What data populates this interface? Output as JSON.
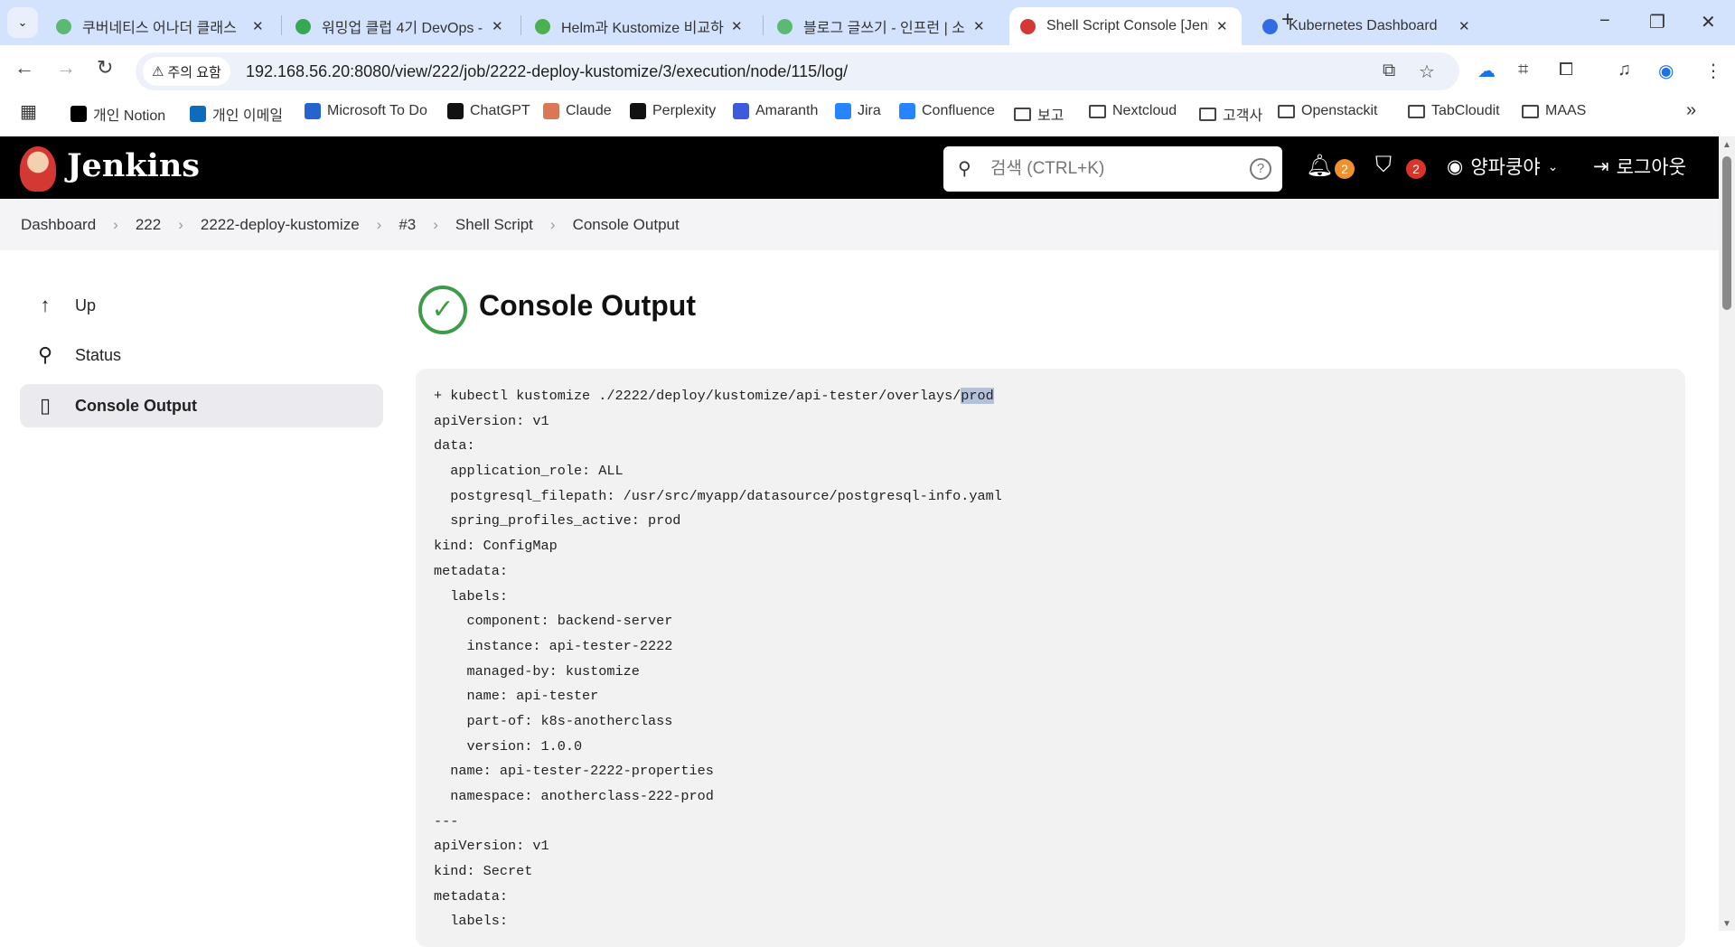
{
  "browser": {
    "tabs": [
      {
        "label": "쿠버네티스 어나더 클래스",
        "color": "#5bb974"
      },
      {
        "label": "워밍업 클럽 4기 DevOps -",
        "color": "#34a853"
      },
      {
        "label": "Helm과 Kustomize 비교하",
        "color": "#4caf50"
      },
      {
        "label": "블로그 글쓰기 - 인프런 | 소",
        "color": "#5bb974"
      },
      {
        "label": "Shell Script Console [Jenki",
        "color": "#d33833",
        "active": true
      },
      {
        "label": "Kubernetes Dashboard",
        "color": "#326ce5"
      }
    ],
    "security_label": "주의 요함",
    "url": "192.168.56.20:8080/view/222/job/2222-deploy-kustomize/3/execution/node/115/log/",
    "bookmarks": [
      {
        "label": "개인 Notion",
        "color": "#000000"
      },
      {
        "label": "개인 이메일",
        "color": "#0f6cbd"
      },
      {
        "label": "Microsoft To Do",
        "color": "#2564cf"
      },
      {
        "label": "ChatGPT",
        "color": "#111111"
      },
      {
        "label": "Claude",
        "color": "#d97757"
      },
      {
        "label": "Perplexity",
        "color": "#111111"
      },
      {
        "label": "Amaranth",
        "color": "#3b5bdb"
      },
      {
        "label": "Jira",
        "color": "#2684ff"
      },
      {
        "label": "Confluence",
        "color": "#2684ff"
      },
      {
        "label": "보고",
        "folder": true
      },
      {
        "label": "Nextcloud",
        "folder": true
      },
      {
        "label": "고객사",
        "folder": true
      },
      {
        "label": "Openstackit",
        "folder": true
      },
      {
        "label": "TabCloudit",
        "folder": true
      },
      {
        "label": "MAAS",
        "folder": true
      }
    ]
  },
  "jenkins": {
    "title": "Jenkins",
    "search_placeholder": "검색 (CTRL+K)",
    "notifications_count": "2",
    "security_count": "2",
    "user": "양파쿵야",
    "logout": "로그아웃",
    "colors": {
      "notif": "#f0912f",
      "security": "#d9342b",
      "success": "#3d9b4a"
    }
  },
  "breadcrumbs": [
    "Dashboard",
    "222",
    "2222-deploy-kustomize",
    "#3",
    "Shell Script",
    "Console Output"
  ],
  "sidebar": [
    {
      "label": "Up",
      "icon": "↑"
    },
    {
      "label": "Status",
      "icon": "⚲"
    },
    {
      "label": "Console Output",
      "icon": "▯",
      "active": true
    }
  ],
  "page_title": "Console Output",
  "console": {
    "command_prefix": "+ kubectl kustomize ./2222/deploy/kustomize/api-tester/overlays/",
    "command_selected": "prod",
    "lines": [
      "apiVersion: v1",
      "data:",
      "  application_role: ALL",
      "  postgresql_filepath: /usr/src/myapp/datasource/postgresql-info.yaml",
      "  spring_profiles_active: prod",
      "kind: ConfigMap",
      "metadata:",
      "  labels:",
      "    component: backend-server",
      "    instance: api-tester-2222",
      "    managed-by: kustomize",
      "    name: api-tester",
      "    part-of: k8s-anotherclass",
      "    version: 1.0.0",
      "  name: api-tester-2222-properties",
      "  namespace: anotherclass-222-prod",
      "---",
      "apiVersion: v1",
      "kind: Secret",
      "metadata:",
      "  labels:"
    ]
  }
}
